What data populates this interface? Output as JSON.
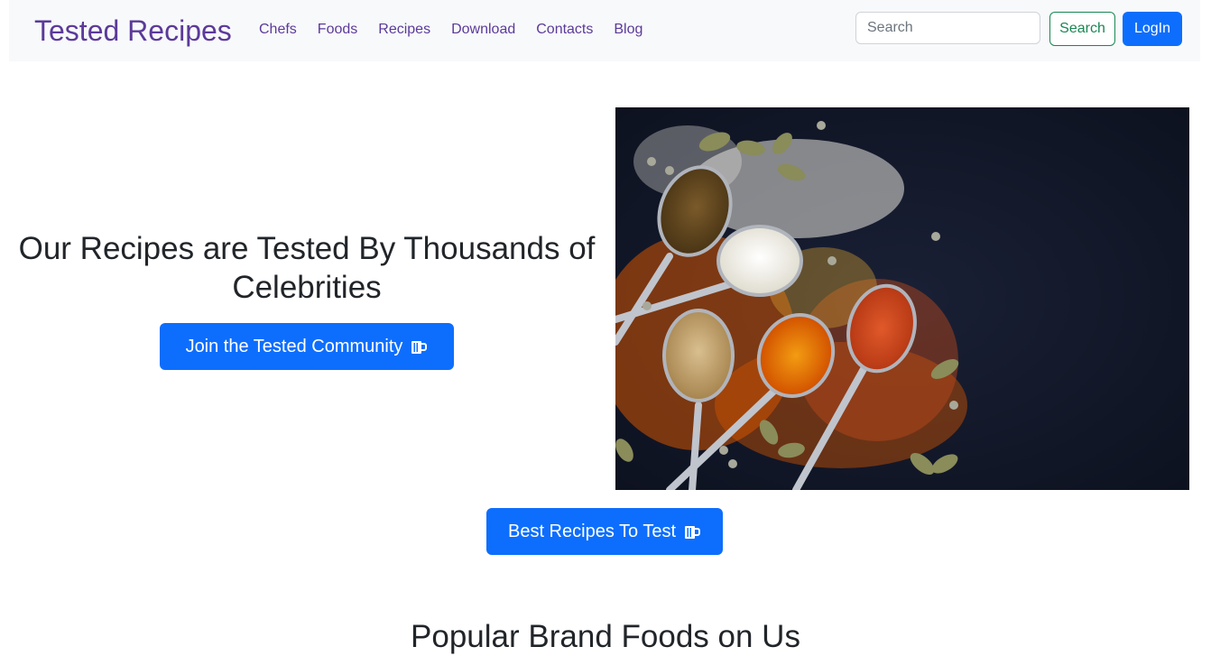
{
  "navbar": {
    "brand": "Tested Recipes",
    "links": [
      "Chefs",
      "Foods",
      "Recipes",
      "Download",
      "Contacts",
      "Blog"
    ],
    "search_placeholder": "Search",
    "search_button": "Search",
    "login_button": "LogIn"
  },
  "hero": {
    "title": "Our Recipes are Tested By Thousands of Celebrities",
    "join_button": "Join the Tested Community",
    "image_icon": "spices-on-spoons-photo"
  },
  "cta": {
    "best_button": "Best Recipes To Test"
  },
  "section": {
    "heading": "Popular Brand Foods on Us"
  },
  "colors": {
    "brand": "#5b3a9a",
    "primary": "#0d6efd",
    "success": "#198754",
    "navbar_bg": "#f8f9fa"
  }
}
